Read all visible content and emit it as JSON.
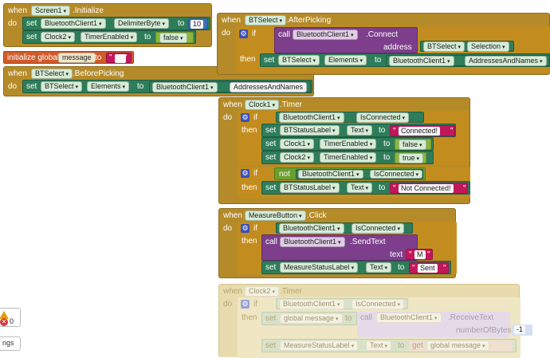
{
  "kw": {
    "when": "when",
    "do": "do",
    "set": "set",
    "to": "to",
    "if": "if",
    "then": "then",
    "call": "call",
    "not": "not",
    "get": "get",
    "initialize_global": "initialize global",
    "address": "address",
    "text": "text",
    "numberOfBytes": "numberOfBytes",
    "dot": ".",
    "quote": "\"",
    "dropdown": "▾"
  },
  "screen1_init": {
    "component": "Screen1",
    "event": "Initialize",
    "row1_comp": "BluetoothClient1",
    "row1_prop": "DelimiterByte",
    "row1_value": "10",
    "row2_comp": "Clock2",
    "row2_prop": "TimerEnabled",
    "row2_value": "false"
  },
  "global_init": {
    "name": "message",
    "value": ""
  },
  "btselect_before": {
    "component": "BTSelect",
    "event": "BeforePicking",
    "set_comp": "BTSelect",
    "set_prop": "Elements",
    "val_comp": "BluetoothClient1",
    "val_prop": "AddressesAndNames"
  },
  "btselect_after": {
    "component": "BTSelect",
    "event": "AfterPicking",
    "call_comp": "BluetoothClient1",
    "call_method": "Connect",
    "addr_comp": "BTSelect",
    "addr_prop": "Selection",
    "set_comp": "BTSelect",
    "set_prop": "Elements",
    "val_comp": "BluetoothClient1",
    "val_prop": "AddressesAndNames"
  },
  "clock1_timer": {
    "component": "Clock1",
    "event": "Timer",
    "cond_comp": "BluetoothClient1",
    "cond_prop": "IsConnected",
    "s1_comp": "BTStatusLabel",
    "s1_prop": "Text",
    "s1_value": "Connected!",
    "s2_comp": "Clock1",
    "s2_prop": "TimerEnabled",
    "s2_value": "false",
    "s3_comp": "Clock2",
    "s3_prop": "TimerEnabled",
    "s3_value": "true",
    "cond2_comp": "BluetoothClient1",
    "cond2_prop": "IsConnected",
    "s4_comp": "BTStatusLabel",
    "s4_prop": "Text",
    "s4_value": "Not Connected!"
  },
  "measure_click": {
    "component": "MeasureButton",
    "event": "Click",
    "cond_comp": "BluetoothClient1",
    "cond_prop": "IsConnected",
    "call_comp": "BluetoothClient1",
    "call_method": "SendText",
    "text_value": "M",
    "set_comp": "MeasureStatusLabel",
    "set_prop": "Text",
    "set_value": "Sent"
  },
  "clock2_timer": {
    "component": "Clock2",
    "event": "Timer",
    "cond_comp": "BluetoothClient1",
    "cond_prop": "IsConnected",
    "set1_var": "global message",
    "call_comp": "BluetoothClient1",
    "call_method": "ReceiveText",
    "bytes_value": "-1",
    "set2_comp": "MeasureStatusLabel",
    "set2_prop": "Text",
    "get_var": "global message"
  },
  "warnings": {
    "count": "0",
    "label": "ngs"
  }
}
